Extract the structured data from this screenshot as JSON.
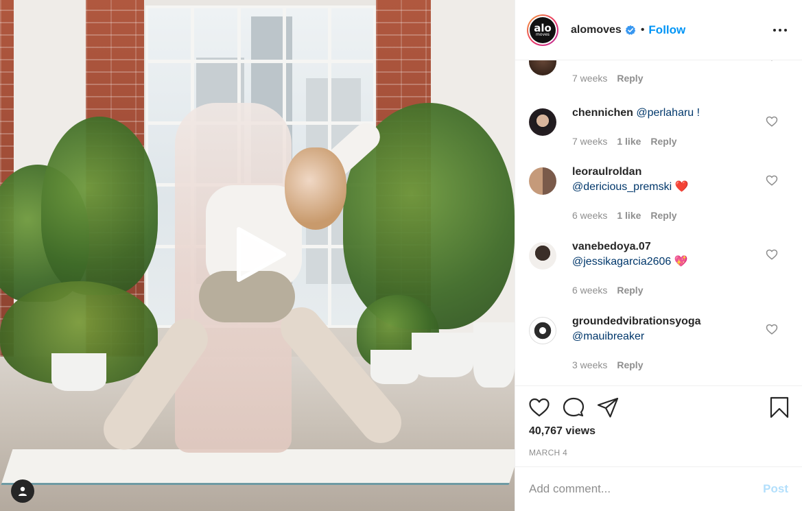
{
  "post": {
    "account": {
      "username": "alomoves",
      "verified": true,
      "follow_label": "Follow",
      "separator": "•",
      "logo_text": "alo",
      "logo_subtext": "moves"
    },
    "media": {
      "type": "video"
    },
    "comments": [
      {
        "username": "",
        "text": "",
        "age": "7 weeks",
        "likes": "",
        "reply_label": "Reply",
        "partially_visible": true
      },
      {
        "username": "chennichen",
        "text": "@perlaharu !",
        "age": "7 weeks",
        "likes": "1 like",
        "reply_label": "Reply"
      },
      {
        "username": "leoraulroldan",
        "text": "@dericious_premski ❤️",
        "age": "6 weeks",
        "likes": "1 like",
        "reply_label": "Reply"
      },
      {
        "username": "vanebedoya.07",
        "text": "@jessikagarcia2606 💖",
        "age": "6 weeks",
        "likes": "",
        "reply_label": "Reply"
      },
      {
        "username": "groundedvibrationsyoga",
        "text": "@mauibreaker",
        "age": "3 weeks",
        "likes": "",
        "reply_label": "Reply"
      }
    ],
    "views": "40,767 views",
    "date": "MARCH 4",
    "add_comment": {
      "placeholder": "Add comment...",
      "post_label": "Post"
    }
  },
  "icons": [
    "play-icon",
    "user-tag-icon",
    "verified-badge-icon",
    "more-options-icon",
    "heart-icon",
    "comment-icon",
    "share-icon",
    "bookmark-icon"
  ],
  "colors": {
    "link_blue": "#0095f6",
    "mention_blue": "#00376b",
    "muted": "#8e8e8e",
    "post_disabled": "#b2dffc"
  }
}
